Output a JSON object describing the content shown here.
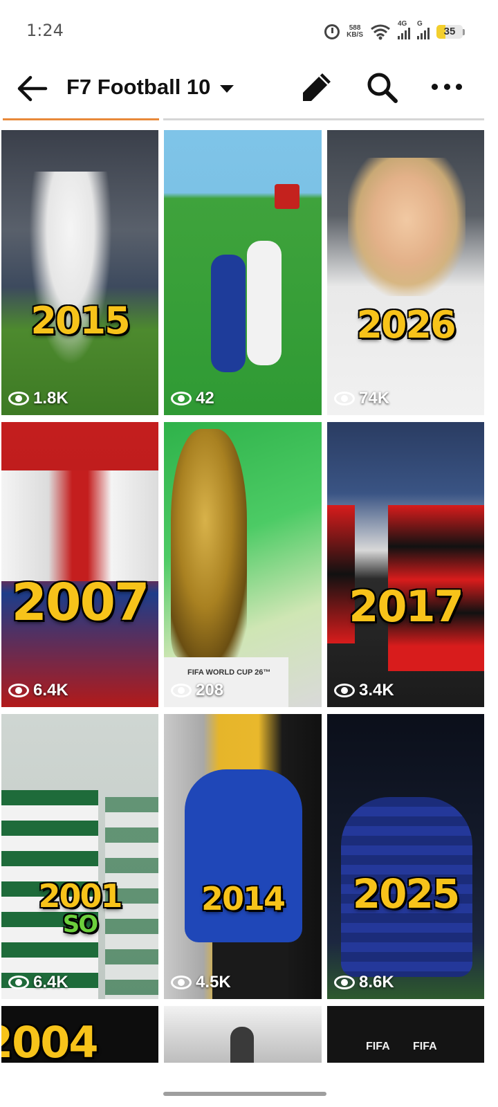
{
  "status_bar": {
    "time": "1:24",
    "net_speed_value": "588",
    "net_speed_unit": "KB/S",
    "signal_1_label": "4G",
    "signal_2_label": "G",
    "battery": "35",
    "battery_level": 0.35,
    "icons": [
      "alarm-icon",
      "wifi-icon",
      "signal-icon",
      "battery-icon"
    ]
  },
  "header": {
    "title": "F7 Football 10",
    "icons": [
      "back-arrow-icon",
      "chevron-down-icon",
      "pencil-icon",
      "search-icon",
      "more-dots-icon"
    ]
  },
  "colors": {
    "accent": "#e8893a",
    "year_text": "#f7c31a"
  },
  "videos": [
    {
      "year": "2015",
      "views": "1.8K"
    },
    {
      "year": "",
      "views": "42"
    },
    {
      "year": "2026",
      "views": "74K"
    },
    {
      "year": "2007",
      "views": "6.4K"
    },
    {
      "year": "",
      "caption": "FIFA WORLD CUP 26™",
      "views": "208"
    },
    {
      "year": "2017",
      "views": "3.4K"
    },
    {
      "year": "2001",
      "subtext": "SO",
      "views": "6.4K"
    },
    {
      "year": "2014",
      "views": "4.5K"
    },
    {
      "year": "2025",
      "views": "8.6K"
    },
    {
      "year": "2004",
      "views": ""
    },
    {
      "year": "",
      "views": ""
    },
    {
      "year": "",
      "caption_left": "FIFA",
      "caption_right": "FIFA",
      "views": ""
    }
  ]
}
